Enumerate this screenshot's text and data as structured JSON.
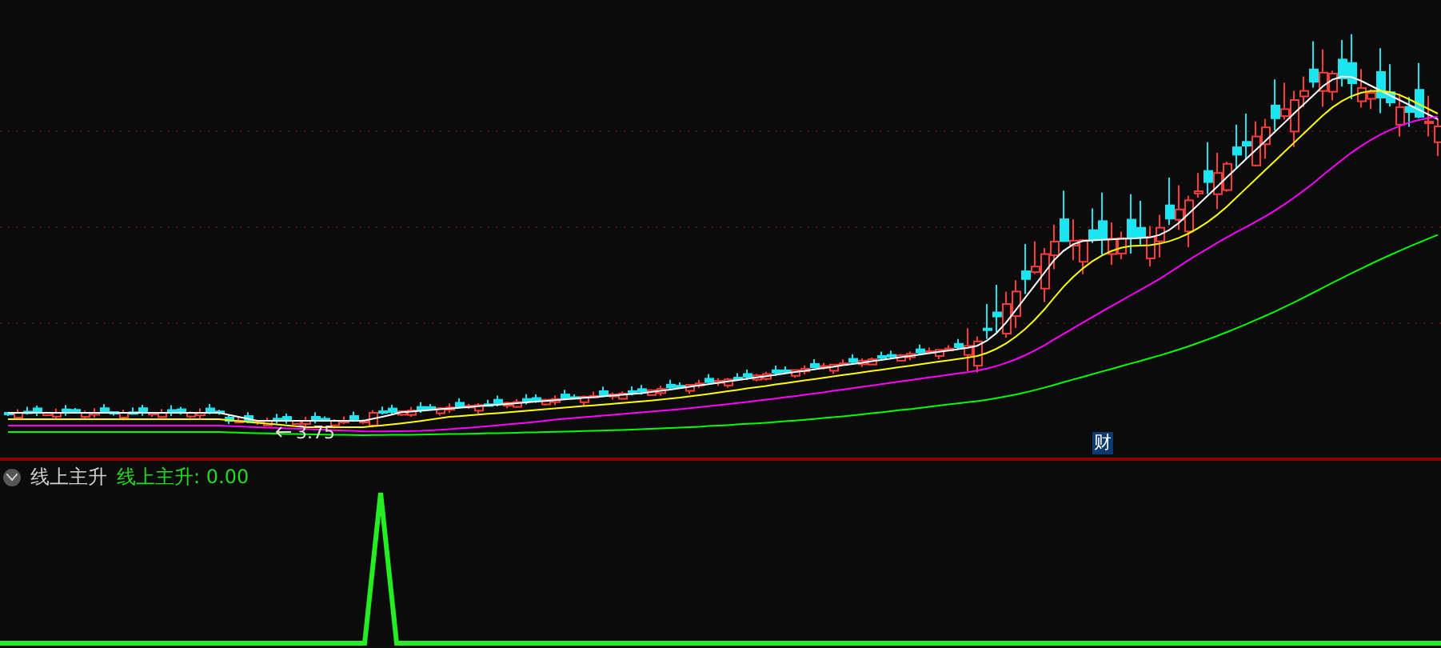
{
  "price_chart": {
    "low_marker": "3.75",
    "event_badge": "财"
  },
  "indicator_panel": {
    "name": "线上主升",
    "series_label": "线上主升:",
    "value": "0.00"
  }
}
